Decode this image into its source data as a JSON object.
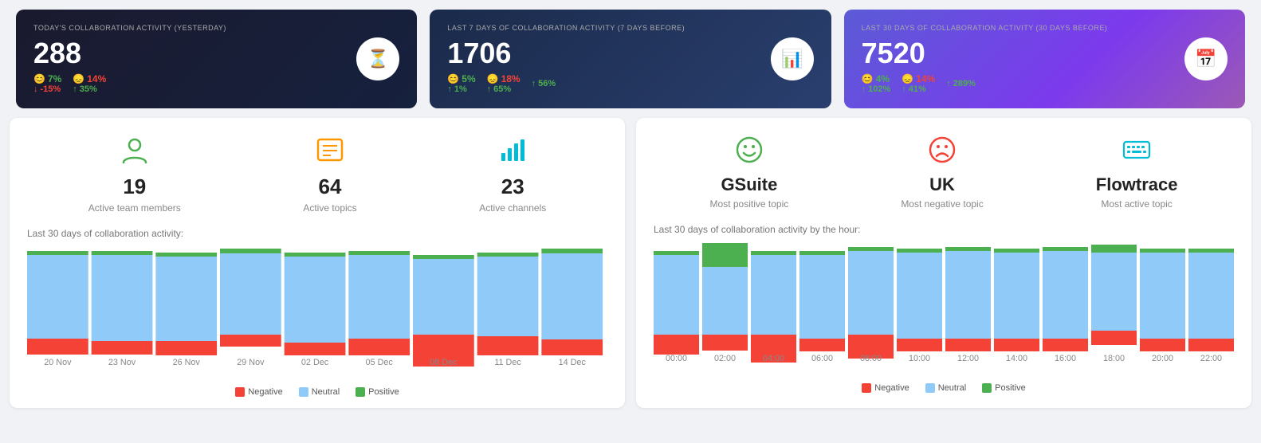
{
  "cards": [
    {
      "id": "today",
      "title": "TODAY'S COLLABORATION ACTIVITY (YESTERDAY)",
      "number": "288",
      "icon": "⏳",
      "stats": [
        {
          "top_val": "7%",
          "top_color": "green",
          "top_icon": "😊",
          "bottom_val": "-15%",
          "bottom_color": "red",
          "bottom_arrow": "↓"
        },
        {
          "top_val": "14%",
          "top_color": "red",
          "top_icon": "😞",
          "bottom_val": "35%",
          "bottom_color": "green",
          "bottom_arrow": "↑"
        }
      ],
      "theme": "dark"
    },
    {
      "id": "week",
      "title": "LAST 7 DAYS OF COLLABORATION ACTIVITY (7 DAYS BEFORE)",
      "number": "1706",
      "icon": "📊",
      "stats": [
        {
          "top_val": "5%",
          "top_color": "green",
          "top_icon": "😊",
          "bottom_val": "1%",
          "bottom_color": "green",
          "bottom_arrow": "↑"
        },
        {
          "top_val": "18%",
          "top_color": "red",
          "top_icon": "😞",
          "bottom_val": "65%",
          "bottom_color": "green",
          "bottom_arrow": "↑"
        },
        {
          "top_val": "",
          "top_color": "green",
          "top_icon": "",
          "bottom_val": "56%",
          "bottom_color": "green",
          "bottom_arrow": "↑"
        }
      ],
      "theme": "blue"
    },
    {
      "id": "month",
      "title": "LAST 30 DAYS OF COLLABORATION ACTIVITY (30 DAYS BEFORE)",
      "number": "7520",
      "icon": "📅",
      "stats": [
        {
          "top_val": "4%",
          "top_color": "green",
          "top_icon": "😊",
          "bottom_val": "102%",
          "bottom_color": "green",
          "bottom_arrow": "↑"
        },
        {
          "top_val": "14%",
          "top_color": "red",
          "top_icon": "😞",
          "bottom_val": "41%",
          "bottom_color": "green",
          "bottom_arrow": "↑"
        },
        {
          "top_val": "",
          "top_color": "green",
          "top_icon": "",
          "bottom_val": "289%",
          "bottom_color": "green",
          "bottom_arrow": "↑"
        }
      ],
      "theme": "purple"
    }
  ],
  "left_panel": {
    "subtitle_chart": "Last 30 days of collaboration activity:",
    "metrics": [
      {
        "id": "team_members",
        "icon": "👤",
        "icon_color": "green",
        "number": "19",
        "label": "Active team members"
      },
      {
        "id": "active_topics",
        "icon": "📰",
        "icon_color": "orange",
        "number": "64",
        "label": "Active topics"
      },
      {
        "id": "active_channels",
        "icon": "📊",
        "icon_color": "cyan",
        "number": "23",
        "label": "Active channels"
      }
    ],
    "x_labels": [
      "20 Nov",
      "23 Nov",
      "26 Nov",
      "29 Nov",
      "02 Dec",
      "05 Dec",
      "08 Dec",
      "11 Dec",
      "14 Dec"
    ],
    "legend": [
      {
        "label": "Negative",
        "color": "#f44336"
      },
      {
        "label": "Neutral",
        "color": "#90caf9"
      },
      {
        "label": "Positive",
        "color": "#4caf50"
      }
    ]
  },
  "right_panel": {
    "subtitle_chart": "Last 30 days of collaboration activity by the hour:",
    "metrics": [
      {
        "id": "most_positive",
        "icon": "😊",
        "icon_color": "green",
        "text": "GSuite",
        "label": "Most positive topic"
      },
      {
        "id": "most_negative",
        "icon": "😞",
        "icon_color": "red",
        "text": "UK",
        "label": "Most negative topic"
      },
      {
        "id": "most_active",
        "icon": "⌨️",
        "icon_color": "cyan",
        "text": "Flowtrace",
        "label": "Most active topic"
      }
    ],
    "x_labels": [
      "00:00",
      "02:00",
      "04:00",
      "06:00",
      "08:00",
      "10:00",
      "12:00",
      "14:00",
      "16:00",
      "18:00",
      "20:00",
      "22:00"
    ],
    "legend": [
      {
        "label": "Negative",
        "color": "#f44336"
      },
      {
        "label": "Neutral",
        "color": "#90caf9"
      },
      {
        "label": "Positive",
        "color": "#4caf50"
      }
    ]
  }
}
